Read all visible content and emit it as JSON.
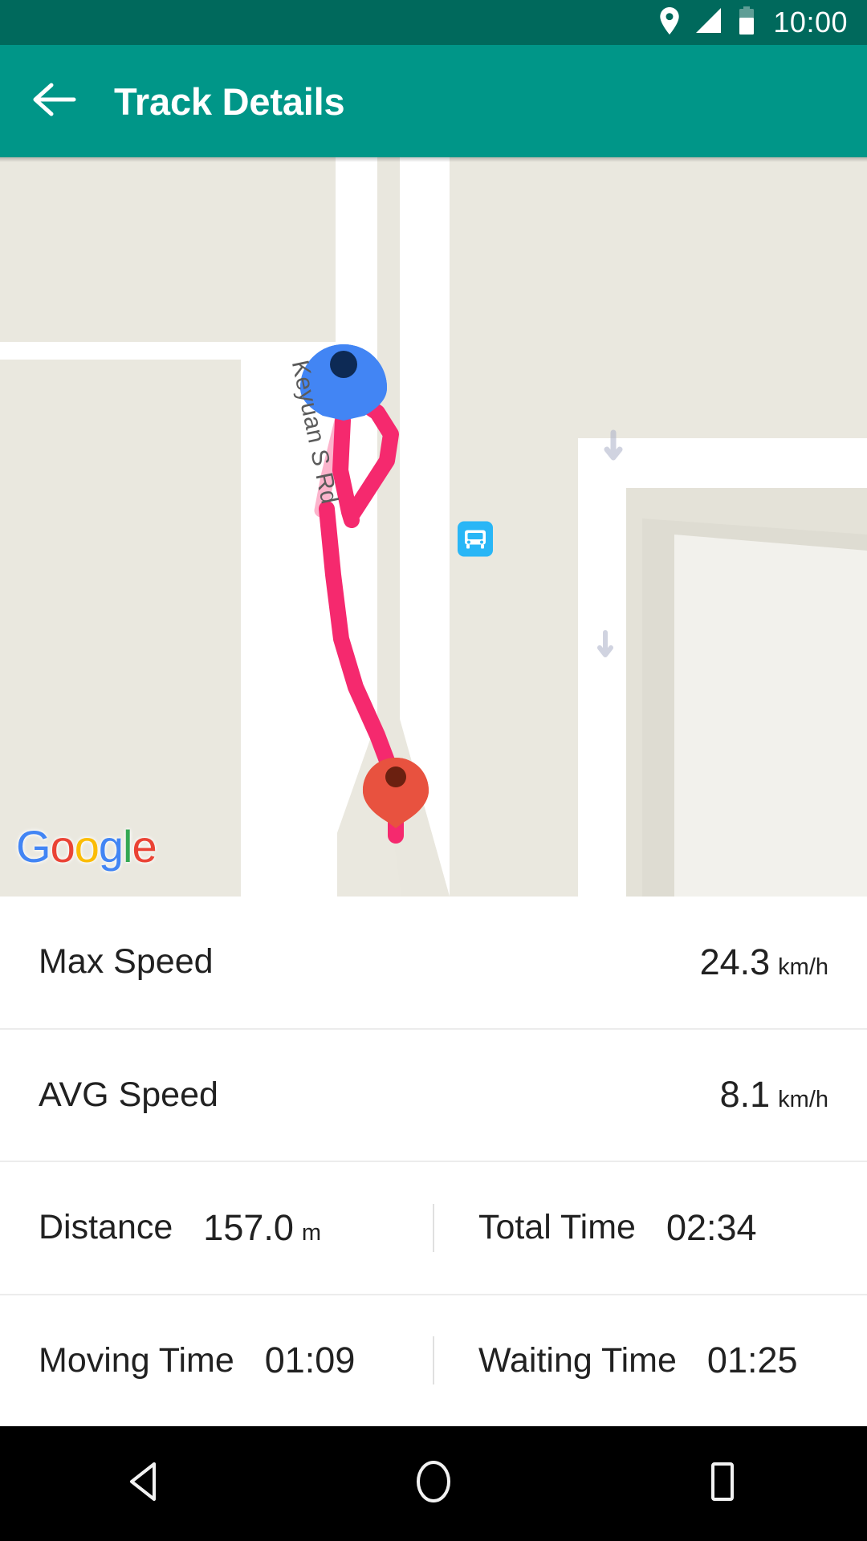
{
  "status_bar": {
    "time": "10:00",
    "icons": [
      "location-pin-icon",
      "signal-icon",
      "battery-icon"
    ],
    "background": "#00695C"
  },
  "app_bar": {
    "title": "Track Details",
    "back_icon": "arrow-back-icon",
    "background": "#009688"
  },
  "map": {
    "provider_logo": {
      "letters": [
        "G",
        "o",
        "o",
        "g",
        "l",
        "e"
      ],
      "colors": [
        "#4285F4",
        "#EA4335",
        "#FBBC05",
        "#4285F4",
        "#34A853",
        "#EA4335"
      ]
    },
    "street_label": "Keyuan S Rd",
    "markers": [
      {
        "name": "start-marker",
        "type": "blue-pin",
        "color": "#4285F4"
      },
      {
        "name": "end-marker",
        "type": "red-pin",
        "color": "#E8523F"
      }
    ],
    "poi": [
      {
        "name": "bus-stop-icon",
        "color": "#29B6F6"
      }
    ],
    "track_color": "#F5296E",
    "land_color": "#EAE8DF",
    "road_color": "#FFFFFF"
  },
  "stats": {
    "rows": [
      {
        "type": "single",
        "label": "Max Speed",
        "value": "24.3",
        "unit": "km/h"
      },
      {
        "type": "single",
        "label": "AVG Speed",
        "value": "8.1",
        "unit": "km/h"
      },
      {
        "type": "double",
        "left": {
          "label": "Distance",
          "value": "157.0",
          "unit": "m"
        },
        "right": {
          "label": "Total Time",
          "value": "02:34",
          "unit": ""
        }
      },
      {
        "type": "double",
        "left": {
          "label": "Moving Time",
          "value": "01:09",
          "unit": ""
        },
        "right": {
          "label": "Waiting Time",
          "value": "01:25",
          "unit": ""
        }
      }
    ]
  },
  "nav_bar": {
    "buttons": [
      "back-triangle-icon",
      "home-circle-icon",
      "recents-square-icon"
    ],
    "background": "#000000"
  }
}
